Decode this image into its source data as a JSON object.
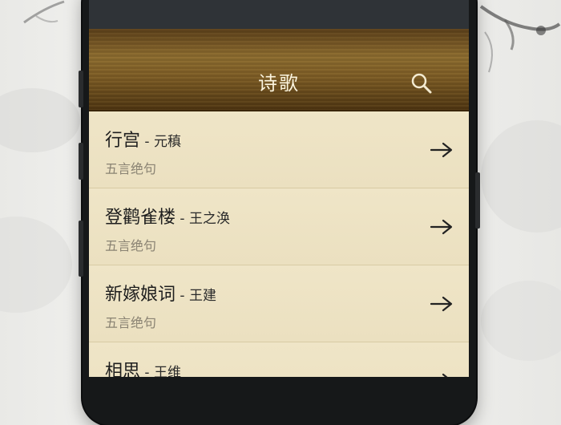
{
  "header": {
    "title": "诗歌",
    "search_icon": "search-icon"
  },
  "poems": [
    {
      "name": "行宫",
      "author": "元稹",
      "form": "五言绝句"
    },
    {
      "name": "登鹳雀楼",
      "author": "王之涣",
      "form": "五言绝句"
    },
    {
      "name": "新嫁娘词",
      "author": "王建",
      "form": "五言绝句"
    },
    {
      "name": "相思",
      "author": "王维",
      "form": ""
    }
  ],
  "icons": {
    "item_arrow": "arrow-right-icon"
  },
  "colors": {
    "header": "#7a5a24",
    "list_background": "#ede3c4",
    "title_text": "#fbf4de",
    "subtitle_text": "#8a8373"
  }
}
